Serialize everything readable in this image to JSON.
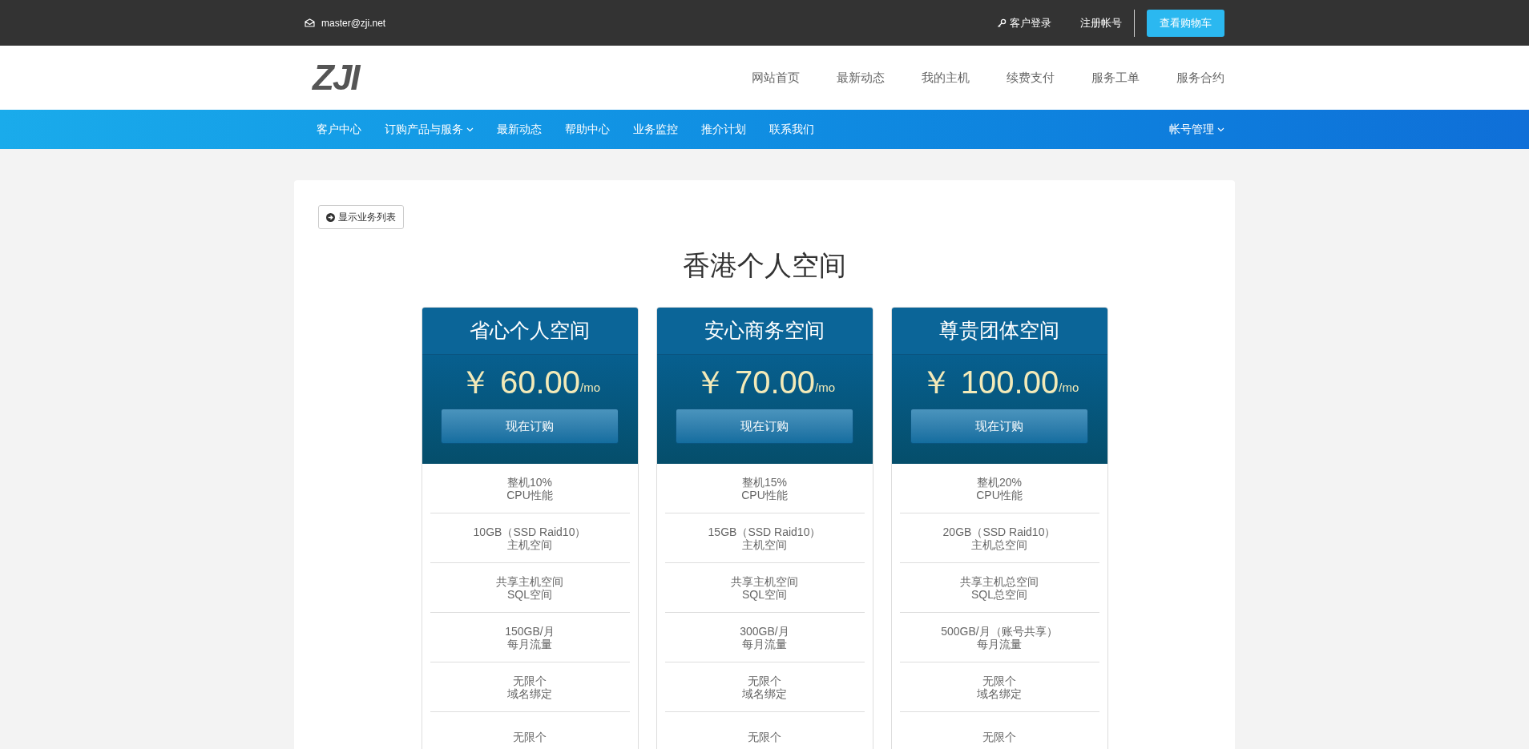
{
  "top_bar": {
    "email": "master@zji.net",
    "login": "客户登录",
    "register": "注册帐号",
    "cart_button": "查看购物车"
  },
  "header": {
    "logo": "ZJI",
    "links": [
      "网站首页",
      "最新动态",
      "我的主机",
      "续费支付",
      "服务工单",
      "服务合约"
    ]
  },
  "nav": {
    "items": [
      {
        "label": "客户中心",
        "dropdown": false
      },
      {
        "label": "订购产品与服务",
        "dropdown": true
      },
      {
        "label": "最新动态",
        "dropdown": false
      },
      {
        "label": "帮助中心",
        "dropdown": false
      },
      {
        "label": "业务监控",
        "dropdown": false
      },
      {
        "label": "推介计划",
        "dropdown": false
      },
      {
        "label": "联系我们",
        "dropdown": false
      }
    ],
    "account": {
      "label": "帐号管理",
      "dropdown": true
    }
  },
  "content": {
    "back_button": "显示业务列表",
    "title": "香港个人空间",
    "plans": [
      {
        "name": "省心个人空间",
        "price": "￥ 60.00",
        "unit": "/mo",
        "button": "现在订购",
        "features": [
          [
            "整机10%",
            "CPU性能"
          ],
          [
            "10GB（SSD Raid10）",
            "主机空间"
          ],
          [
            "共享主机空间",
            "SQL空间"
          ],
          [
            "150GB/月",
            "每月流量"
          ],
          [
            "无限个",
            "域名绑定"
          ],
          [
            "无限个"
          ]
        ]
      },
      {
        "name": "安心商务空间",
        "price": "￥ 70.00",
        "unit": "/mo",
        "button": "现在订购",
        "features": [
          [
            "整机15%",
            "CPU性能"
          ],
          [
            "15GB（SSD Raid10）",
            "主机空间"
          ],
          [
            "共享主机空间",
            "SQL空间"
          ],
          [
            "300GB/月",
            "每月流量"
          ],
          [
            "无限个",
            "域名绑定"
          ],
          [
            "无限个"
          ]
        ]
      },
      {
        "name": "尊贵团体空间",
        "price": "￥ 100.00",
        "unit": "/mo",
        "button": "现在订购",
        "features": [
          [
            "整机20%",
            "CPU性能"
          ],
          [
            "20GB（SSD Raid10）",
            "主机总空间"
          ],
          [
            "共享主机总空间",
            "SQL总空间"
          ],
          [
            "500GB/月（账号共享）",
            "每月流量"
          ],
          [
            "无限个",
            "域名绑定"
          ],
          [
            "无限个"
          ]
        ]
      }
    ]
  }
}
